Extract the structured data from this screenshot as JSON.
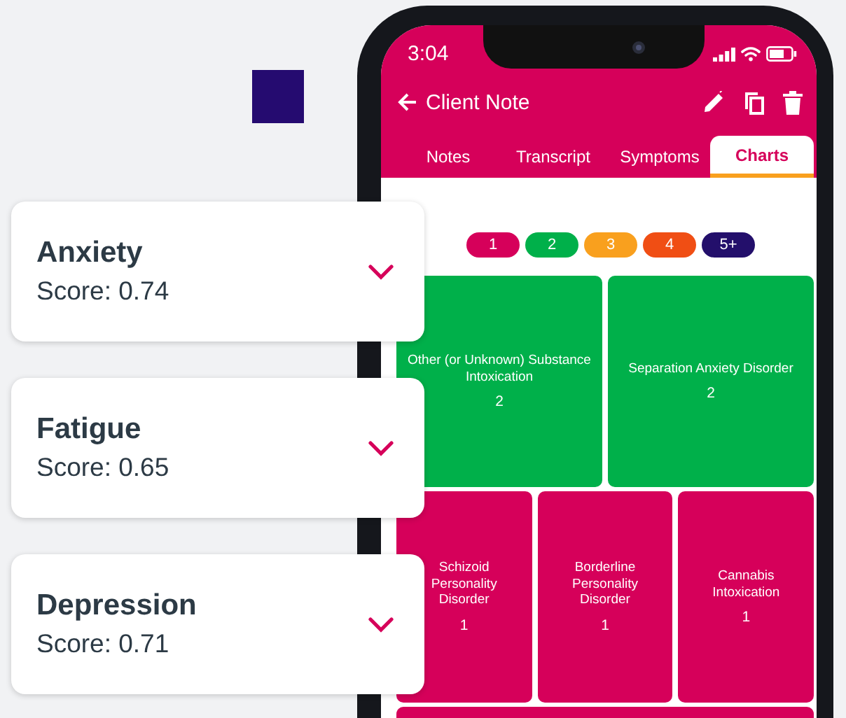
{
  "phone": {
    "status_bar": {
      "time": "3:04"
    },
    "app_bar": {
      "title": "Client Note"
    },
    "tabs": [
      {
        "label": "Notes",
        "selected": false
      },
      {
        "label": "Transcript",
        "selected": false
      },
      {
        "label": "Symptoms",
        "selected": false
      },
      {
        "label": "Charts",
        "selected": true
      }
    ],
    "legend": [
      {
        "label": "1",
        "color": "#d6005a"
      },
      {
        "label": "2",
        "color": "#00b04a"
      },
      {
        "label": "3",
        "color": "#f9a01e"
      },
      {
        "label": "4",
        "color": "#f04e14"
      },
      {
        "label": "5+",
        "color": "#230f6b"
      }
    ],
    "treemap": {
      "rows": [
        [
          {
            "label": "Other (or Unknown) Substance Intoxication",
            "count": "2",
            "color": "#00b04a"
          },
          {
            "label": "Separation Anxiety Disorder",
            "count": "2",
            "color": "#00b04a"
          }
        ],
        [
          {
            "label": "Schizoid Personality Disorder",
            "count": "1",
            "color": "#d6005a"
          },
          {
            "label": "Borderline Personality Disorder",
            "count": "1",
            "color": "#d6005a"
          },
          {
            "label": "Cannabis Intoxication",
            "count": "1",
            "color": "#d6005a"
          }
        ],
        [
          {
            "color": "#d6005a"
          }
        ]
      ]
    }
  },
  "symptom_cards": [
    {
      "title": "Anxiety",
      "score": "Score: 0.74"
    },
    {
      "title": "Fatigue",
      "score": "Score: 0.65"
    },
    {
      "title": "Depression",
      "score": "Score: 0.71"
    }
  ]
}
